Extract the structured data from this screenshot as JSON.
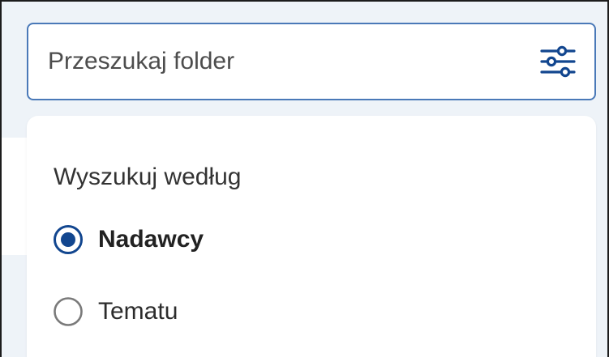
{
  "search": {
    "placeholder": "Przeszukaj folder",
    "value": "",
    "filter_icon": "sliders-icon"
  },
  "search_by_panel": {
    "heading": "Wyszukuj według",
    "options": [
      {
        "label": "Nadawcy",
        "checked": true
      },
      {
        "label": "Tematu",
        "checked": false
      }
    ]
  },
  "colors": {
    "accent": "#12468f",
    "border": "#4a79b8",
    "background": "#eef3f8",
    "radio_unchecked": "#7a7a7a"
  }
}
